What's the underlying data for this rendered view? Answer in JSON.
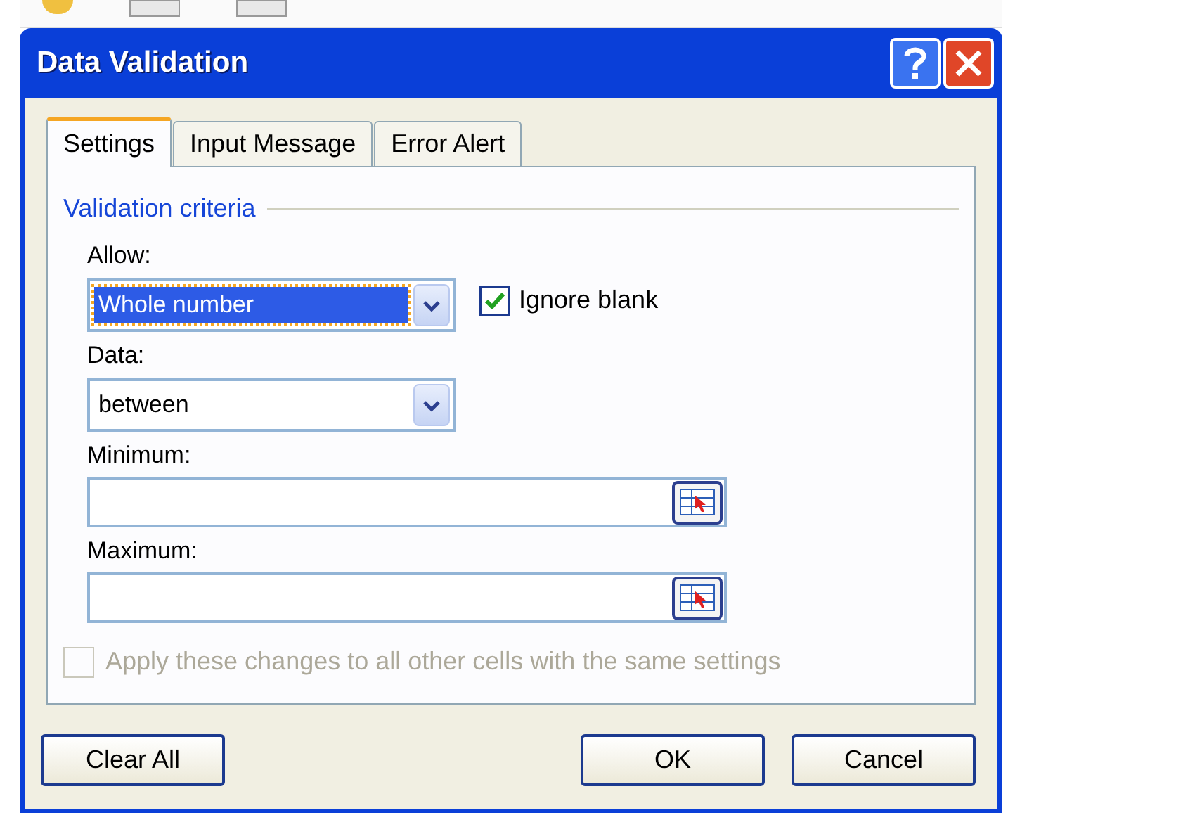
{
  "window": {
    "title": "Data Validation"
  },
  "tabs": [
    {
      "label": "Settings",
      "selected": true
    },
    {
      "label": "Input Message",
      "selected": false
    },
    {
      "label": "Error Alert",
      "selected": false
    }
  ],
  "criteria": {
    "heading": "Validation criteria",
    "allow": {
      "label": "Allow:",
      "value": "Whole number",
      "focused": true
    },
    "ignore_blank": {
      "label": "Ignore blank",
      "checked": true
    },
    "data": {
      "label": "Data:",
      "value": "between",
      "focused": false
    },
    "minimum": {
      "label": "Minimum:"
    },
    "maximum": {
      "label": "Maximum:"
    }
  },
  "apply_all": {
    "label": "Apply these changes to all other cells with the same settings",
    "checked": false,
    "disabled": true
  },
  "buttons": [
    {
      "label": "Clear All",
      "kind": "left"
    },
    {
      "label": "OK",
      "kind": "right"
    },
    {
      "label": "Cancel",
      "kind": "right"
    }
  ]
}
